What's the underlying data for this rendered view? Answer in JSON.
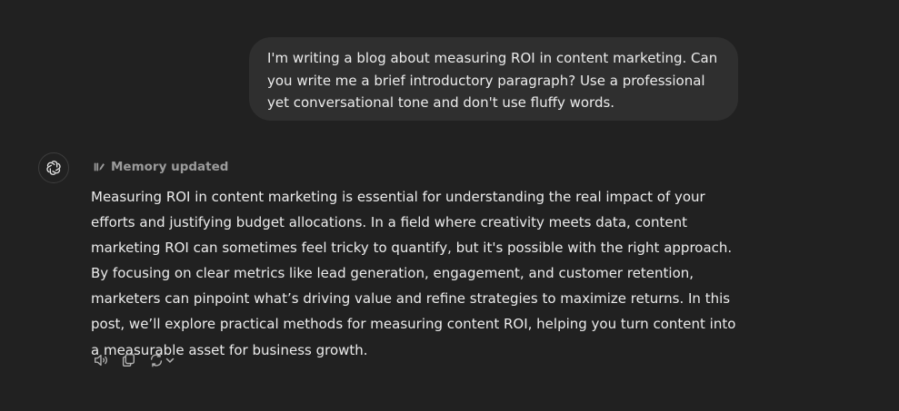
{
  "user_message": {
    "text": "I'm writing a blog about measuring ROI in content marketing. Can you write me a brief introductory paragraph? Use a professional yet conversational tone and don't use fluffy words."
  },
  "assistant": {
    "avatar_icon": "openai-logo-icon",
    "memory_status": {
      "icon": "memory-edit-icon",
      "label": "Memory updated"
    },
    "response_text": "Measuring ROI in content marketing is essential for understanding the real impact of your efforts and justifying budget allocations. In a field where creativity meets data, content marketing ROI can sometimes feel tricky to quantify, but it's possible with the right approach. By focusing on clear metrics like lead generation, engagement, and customer retention, marketers can pinpoint what’s driving value and refine strategies to maximize returns. In this post, we’ll explore practical methods for measuring content ROI, helping you turn content into a measurable asset for business growth.",
    "actions": [
      {
        "name": "read-aloud",
        "icon": "speaker-icon"
      },
      {
        "name": "copy",
        "icon": "copy-icon"
      },
      {
        "name": "regenerate",
        "icon": "refresh-icon"
      }
    ]
  },
  "colors": {
    "background": "#212121",
    "user_bubble": "#2f2f2f",
    "text": "#ececec",
    "muted": "#9b9b9b"
  }
}
